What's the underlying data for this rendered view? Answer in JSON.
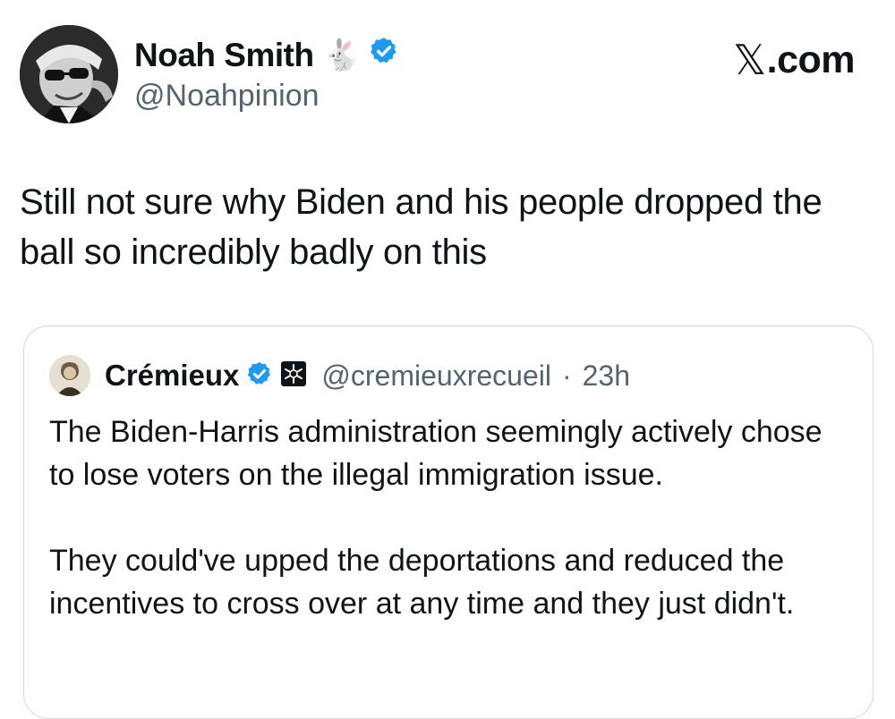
{
  "author": {
    "name": "Noah Smith",
    "handle": "@Noahpinion",
    "emoji": "🐇",
    "verified_color": "#1d9bf0"
  },
  "brand": {
    "text": ".com",
    "icon": "x-logo-icon"
  },
  "tweet": {
    "text": "Still not sure why Biden and his people dropped the ball so incredibly badly on this"
  },
  "quote": {
    "name": "Crémieux",
    "handle": "@cremieuxrecueil",
    "separator": "·",
    "time": "23h",
    "paragraphs": [
      "The Biden-Harris administration seemingly actively chose to lose voters on the illegal immigration issue.",
      "They could've upped the deportations and reduced the incentives to cross over at any time and they just didn't."
    ]
  },
  "colors": {
    "text": "#0f1419",
    "secondary": "#536471",
    "border": "#cfd9de"
  }
}
